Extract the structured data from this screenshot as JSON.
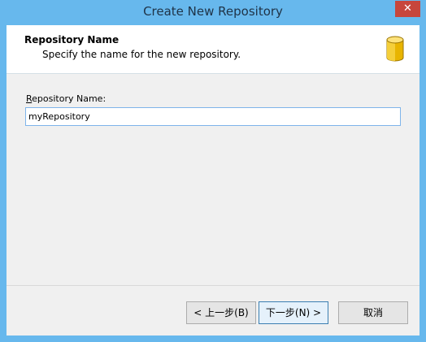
{
  "window": {
    "title": "Create New Repository",
    "close_glyph": "✕"
  },
  "header": {
    "title": "Repository Name",
    "subtitle": "Specify the name for the new repository.",
    "icon": "database-icon"
  },
  "form": {
    "label_mnemonic": "R",
    "label_rest": "epository Name:",
    "repository_name_value": "myRepository"
  },
  "buttons": {
    "back": "< 上一步(B)",
    "next": "下一步(N) >",
    "cancel": "取消"
  },
  "colors": {
    "titlebar": "#67b8ed",
    "close": "#c7463c",
    "icon_gold": "#e8b400"
  }
}
